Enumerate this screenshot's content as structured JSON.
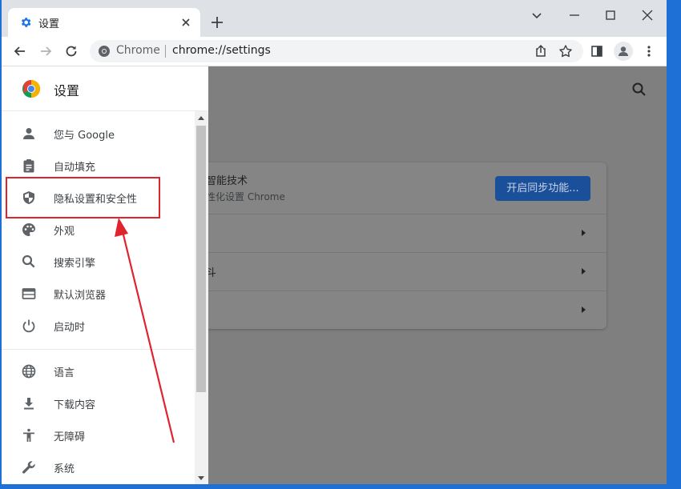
{
  "browser": {
    "tab_title": "设置",
    "omnibox_host": "Chrome",
    "omnibox_url": "chrome://settings"
  },
  "drawer": {
    "title": "设置",
    "items": [
      {
        "label": "您与 Google",
        "icon": "person-icon"
      },
      {
        "label": "自动填充",
        "icon": "clipboard-icon"
      },
      {
        "label": "隐私设置和安全性",
        "icon": "shield-icon"
      },
      {
        "label": "外观",
        "icon": "palette-icon"
      },
      {
        "label": "搜索引擎",
        "icon": "search-icon"
      },
      {
        "label": "默认浏览器",
        "icon": "browser-window-icon"
      },
      {
        "label": "启动时",
        "icon": "power-icon"
      },
      {
        "label": "语言",
        "icon": "globe-icon"
      },
      {
        "label": "下载内容",
        "icon": "download-icon"
      },
      {
        "label": "无障碍",
        "icon": "accessibility-icon"
      },
      {
        "label": "系统",
        "icon": "wrench-icon"
      }
    ]
  },
  "main": {
    "card_line1": "智能技术",
    "card_line2": "性化设置 Chrome",
    "sync_button": "开启同步功能...",
    "row_labels": [
      "",
      "斗",
      ""
    ]
  },
  "colors": {
    "accent_blue": "#1a73e8",
    "annotation_red": "#e0242e",
    "desktop_blue": "#1e6fd6"
  }
}
